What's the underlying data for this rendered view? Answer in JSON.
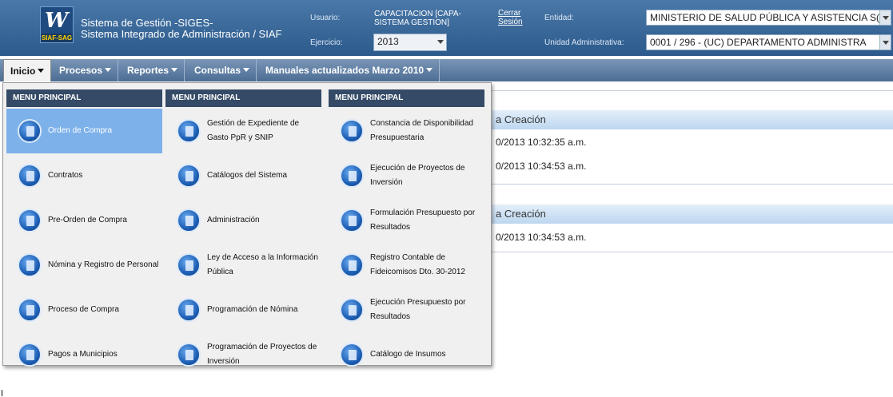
{
  "header": {
    "logo_mark": "W",
    "logo_tag": "SIAF-SAG",
    "system_line1": "Sistema de Gestión -SIGES-",
    "system_line2": "Sistema Integrado de Administración / SIAF",
    "usuario_label": "Usuario:",
    "usuario_value_1": "CAPACITACION [CAPA-",
    "usuario_value_2": "SISTEMA GESTION]",
    "cerrar_1": "Cerrar",
    "cerrar_2": "Sesión",
    "ejercicio_label": "Ejercicio:",
    "ejercicio_value": "2013",
    "entidad_label": "Entidad:",
    "entidad_value": "MINISTERIO DE SALUD PÚBLICA Y ASISTENCIA S(",
    "unidad_label": "Unidad Administrativa:",
    "unidad_value": "0001 / 296 - (UC) DEPARTAMENTO ADMINISTRA"
  },
  "nav": {
    "items": [
      "Inicio",
      "Procesos",
      "Reportes",
      "Consultas",
      "Manuales actualizados Marzo 2010"
    ]
  },
  "background": {
    "header1": "a Creación",
    "row1": "0/2013 10:32:35 a.m.",
    "row2": "0/2013 10:34:53 a.m.",
    "header2": "a Creación",
    "row3": "0/2013 10:34:53 a.m."
  },
  "menu": {
    "columns": [
      {
        "title": "MENU PRINCIPAL",
        "items": [
          "Orden de Compra",
          "Contratos",
          "Pre-Orden de Compra",
          "Nómina y Registro de Personal",
          "Proceso de Compra",
          "Pagos a Municipios"
        ]
      },
      {
        "title": "MENU PRINCIPAL",
        "items": [
          "Gestión de Expediente de Gasto PpR y SNIP",
          "Catálogos del Sistema",
          "Administración",
          "Ley de Acceso a la Información Pública",
          "Programación de Nómina",
          "Programación de Proyectos de Inversión"
        ]
      },
      {
        "title": "MENU PRINCIPAL",
        "items": [
          "Constancia de Disponibilidad Presupuestaria",
          "Ejecución de Proyectos de Inversión",
          "Formulación Presupuesto por Resultados",
          "Registro Contable de Fideicomisos Dto. 30-2012",
          "Ejecución Presupuesto por Resultados",
          "Catálogo de Insumos"
        ]
      }
    ]
  },
  "colors": {
    "header_bg": "#2c5a8c",
    "menu_header": "#344a66",
    "selected_item": "#7db1ea"
  }
}
